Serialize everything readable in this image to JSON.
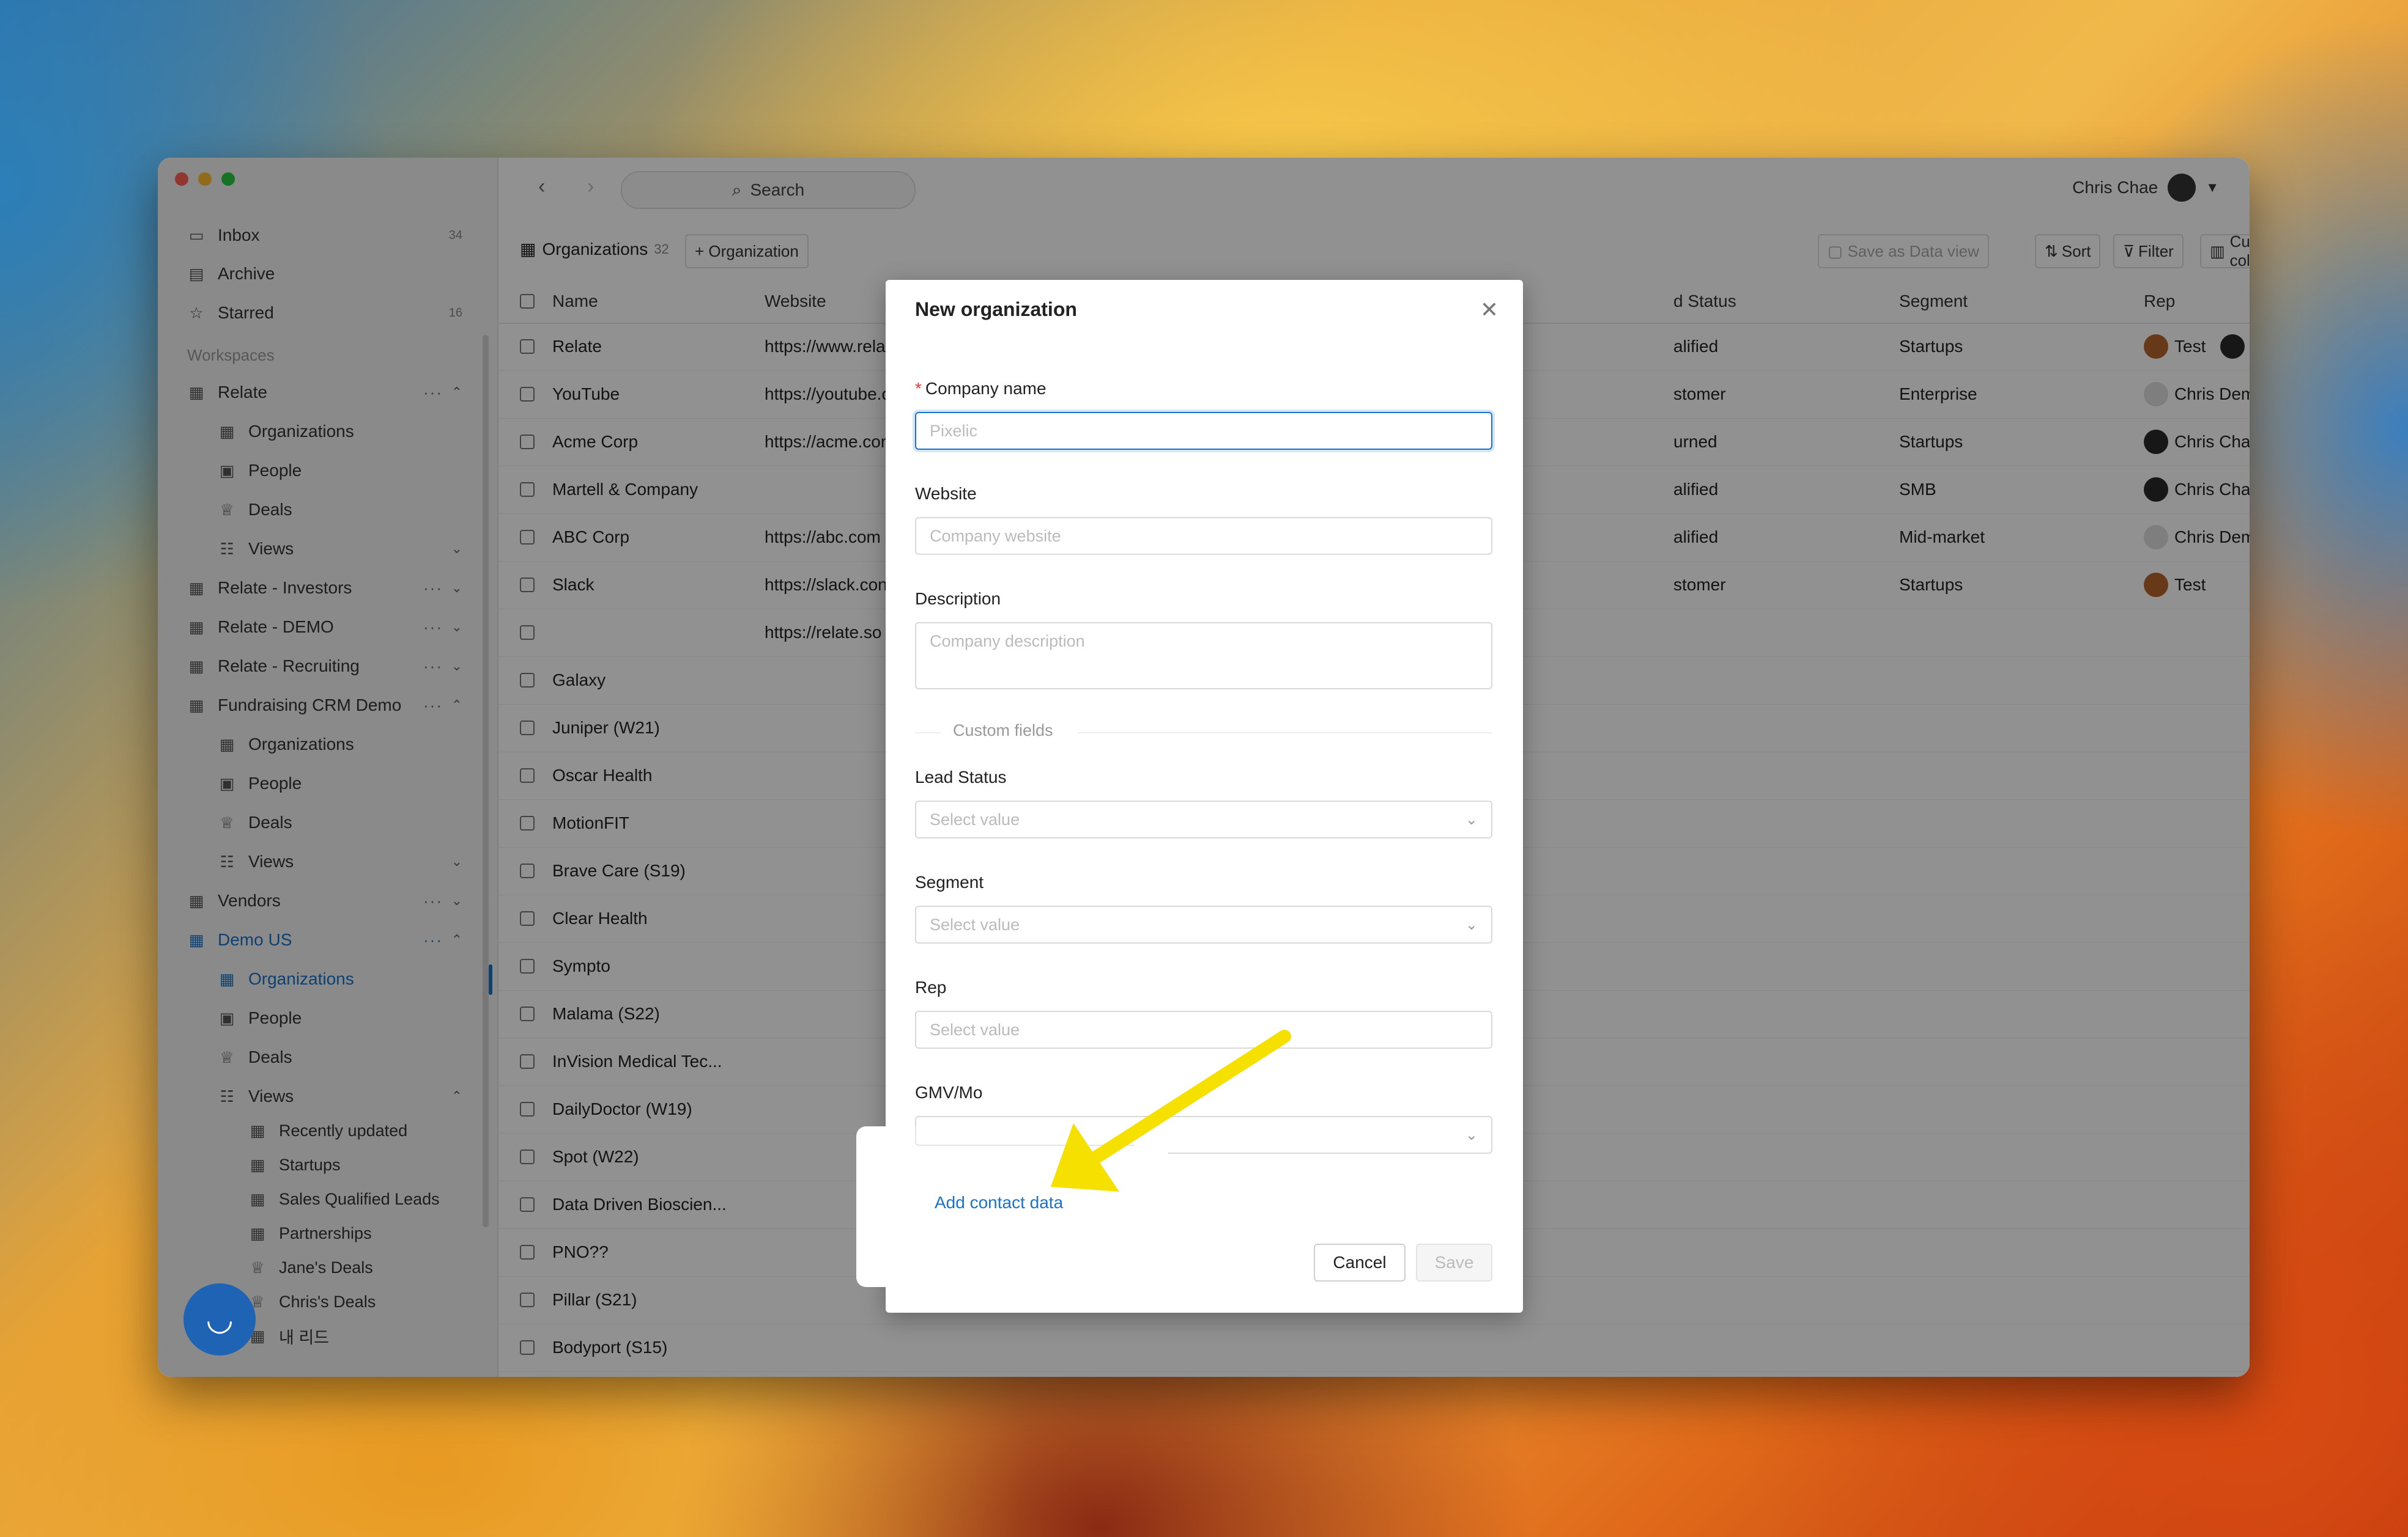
{
  "sidebar": {
    "inbox": {
      "label": "Inbox",
      "count": "34"
    },
    "archive": {
      "label": "Archive"
    },
    "starred": {
      "label": "Starred",
      "count": "16"
    },
    "workspaces_heading": "Workspaces",
    "relate": {
      "label": "Relate",
      "organizations": "Organizations",
      "people": "People",
      "deals": "Deals",
      "views": "Views"
    },
    "relate_investors": "Relate - Investors",
    "relate_demo": "Relate - DEMO",
    "relate_recruiting": "Relate - Recruiting",
    "fundraising": {
      "label": "Fundraising CRM Demo",
      "organizations": "Organizations",
      "people": "People",
      "deals": "Deals",
      "views": "Views"
    },
    "vendors": "Vendors",
    "demo_us": {
      "label": "Demo US",
      "organizations": "Organizations",
      "people": "People",
      "deals": "Deals",
      "views": "Views",
      "view_items": [
        "Recently updated",
        "Startups",
        "Sales Qualified Leads",
        "Partnerships",
        "Jane's Deals",
        "Chris's Deals",
        "내 리드"
      ]
    }
  },
  "topbar": {
    "search": "Search",
    "user": "Chris Chae"
  },
  "toolbar": {
    "tab_label": "Organizations",
    "tab_count": "32",
    "add_org": "+ Organization",
    "save_view": "Save as Data view",
    "sort": "Sort",
    "filter": "Filter",
    "customize": "Customize columns"
  },
  "table": {
    "headers": {
      "name": "Name",
      "website": "Website",
      "lead_status": "d Status",
      "segment": "Segment",
      "rep": "Rep"
    },
    "rows": [
      {
        "name": "Relate",
        "website": "https://www.rela",
        "status": "alified",
        "segment": "Startups",
        "rep": "Test",
        "rep2": "Chris Chae"
      },
      {
        "name": "YouTube",
        "website": "https://youtube.c",
        "status": "stomer",
        "segment": "Enterprise",
        "rep": "Chris Demo",
        "rep2": ""
      },
      {
        "name": "Acme Corp",
        "website": "https://acme.con",
        "status": "urned",
        "segment": "Startups",
        "rep": "Chris Chae",
        "rep2": ""
      },
      {
        "name": "Martell & Company",
        "website": "",
        "status": "alified",
        "segment": "SMB",
        "rep": "Chris Chae",
        "rep2": ""
      },
      {
        "name": "ABC Corp",
        "website": "https://abc.com",
        "status": "alified",
        "segment": "Mid-market",
        "rep": "Chris Demo",
        "rep2": ""
      },
      {
        "name": "Slack",
        "website": "https://slack.con",
        "status": "stomer",
        "segment": "Startups",
        "rep": "Test",
        "rep2": ""
      },
      {
        "name": "",
        "website": "https://relate.so",
        "status": "",
        "segment": "",
        "rep": "",
        "rep2": ""
      },
      {
        "name": "Galaxy",
        "website": "",
        "status": "",
        "segment": "",
        "rep": "",
        "rep2": ""
      },
      {
        "name": "Juniper (W21)",
        "website": "",
        "status": "",
        "segment": "",
        "rep": "",
        "rep2": ""
      },
      {
        "name": "Oscar Health",
        "website": "",
        "status": "",
        "segment": "",
        "rep": "",
        "rep2": ""
      },
      {
        "name": "MotionFIT",
        "website": "",
        "status": "",
        "segment": "",
        "rep": "",
        "rep2": ""
      },
      {
        "name": "Brave Care (S19)",
        "website": "",
        "status": "",
        "segment": "",
        "rep": "",
        "rep2": ""
      },
      {
        "name": "Clear Health",
        "website": "",
        "status": "",
        "segment": "",
        "rep": "",
        "rep2": ""
      },
      {
        "name": "Sympto",
        "website": "",
        "status": "",
        "segment": "",
        "rep": "",
        "rep2": ""
      },
      {
        "name": "Malama (S22)",
        "website": "",
        "status": "",
        "segment": "",
        "rep": "",
        "rep2": ""
      },
      {
        "name": "InVision Medical Tec...",
        "website": "",
        "status": "",
        "segment": "",
        "rep": "",
        "rep2": ""
      },
      {
        "name": "DailyDoctor (W19)",
        "website": "",
        "status": "",
        "segment": "",
        "rep": "",
        "rep2": ""
      },
      {
        "name": "Spot (W22)",
        "website": "",
        "status": "",
        "segment": "",
        "rep": "",
        "rep2": ""
      },
      {
        "name": "Data Driven Bioscien...",
        "website": "",
        "status": "",
        "segment": "",
        "rep": "",
        "rep2": ""
      },
      {
        "name": "PNO??",
        "website": "",
        "status": "",
        "segment": "",
        "rep": "",
        "rep2": ""
      },
      {
        "name": "Pillar (S21)",
        "website": "",
        "status": "",
        "segment": "",
        "rep": "",
        "rep2": ""
      },
      {
        "name": "Bodyport (S15)",
        "website": "",
        "status": "",
        "segment": "",
        "rep": "",
        "rep2": ""
      }
    ]
  },
  "modal": {
    "title": "New organization",
    "required_mark": "*",
    "company_name_label": "Company name",
    "company_name_placeholder": "Pixelic",
    "website_label": "Website",
    "website_placeholder": "Company website",
    "description_label": "Description",
    "description_placeholder": "Company description",
    "custom_fields": "Custom fields",
    "lead_status_label": "Lead Status",
    "segment_label": "Segment",
    "rep_label": "Rep",
    "gmv_label": "GMV/Mo",
    "select_placeholder": "Select value",
    "add_contact": "Add contact data",
    "cancel": "Cancel",
    "save": "Save"
  },
  "colors": {
    "accent": "#1a73c9",
    "arrow": "#f5e000"
  }
}
